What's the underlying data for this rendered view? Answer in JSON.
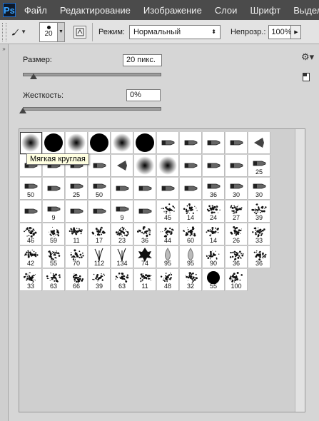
{
  "app": {
    "logo": "Ps"
  },
  "menubar": {
    "items": [
      "Файл",
      "Редактирование",
      "Изображение",
      "Слои",
      "Шрифт",
      "Выделен"
    ]
  },
  "options_bar": {
    "brush_size_value": "20",
    "mode_label": "Режим:",
    "mode_value": "Нормальный",
    "opacity_label": "Непрозр.:",
    "opacity_value": "100%"
  },
  "brush_popup": {
    "size_label": "Размер:",
    "size_value": "20 пикс.",
    "size_slider_fraction": 0.08,
    "hardness_label": "Жесткость:",
    "hardness_value": "0%",
    "hardness_slider_fraction": 0.0,
    "tooltip": "Мягкая круглая",
    "presets": [
      {
        "kind": "soft",
        "label": ""
      },
      {
        "kind": "hard",
        "label": ""
      },
      {
        "kind": "soft",
        "label": ""
      },
      {
        "kind": "hard",
        "label": ""
      },
      {
        "kind": "soft",
        "label": ""
      },
      {
        "kind": "hard",
        "label": ""
      },
      {
        "kind": "marker",
        "label": ""
      },
      {
        "kind": "marker",
        "label": ""
      },
      {
        "kind": "marker",
        "label": ""
      },
      {
        "kind": "marker",
        "label": ""
      },
      {
        "kind": "fan",
        "label": ""
      },
      {
        "kind": "marker",
        "label": ""
      },
      {
        "kind": "marker",
        "label": ""
      },
      {
        "kind": "marker",
        "label": ""
      },
      {
        "kind": "marker",
        "label": ""
      },
      {
        "kind": "fan",
        "label": ""
      },
      {
        "kind": "soft",
        "label": ""
      },
      {
        "kind": "soft",
        "label": ""
      },
      {
        "kind": "marker",
        "label": ""
      },
      {
        "kind": "marker",
        "label": ""
      },
      {
        "kind": "marker",
        "label": ""
      },
      {
        "kind": "marker",
        "label": "25"
      },
      {
        "kind": "marker",
        "label": "50"
      },
      {
        "kind": "marker",
        "label": ""
      },
      {
        "kind": "marker",
        "label": "25"
      },
      {
        "kind": "marker",
        "label": "50"
      },
      {
        "kind": "marker",
        "label": ""
      },
      {
        "kind": "marker",
        "label": ""
      },
      {
        "kind": "marker",
        "label": ""
      },
      {
        "kind": "marker",
        "label": ""
      },
      {
        "kind": "marker",
        "label": "36"
      },
      {
        "kind": "marker",
        "label": "30"
      },
      {
        "kind": "marker",
        "label": "30"
      },
      {
        "kind": "marker",
        "label": ""
      },
      {
        "kind": "marker",
        "label": "9"
      },
      {
        "kind": "marker",
        "label": ""
      },
      {
        "kind": "marker",
        "label": ""
      },
      {
        "kind": "marker",
        "label": "9"
      },
      {
        "kind": "marker",
        "label": ""
      },
      {
        "kind": "texture",
        "label": "45"
      },
      {
        "kind": "texture",
        "label": "14"
      },
      {
        "kind": "texture",
        "label": "24"
      },
      {
        "kind": "texture",
        "label": "27"
      },
      {
        "kind": "texture",
        "label": "39"
      },
      {
        "kind": "texture",
        "label": "46"
      },
      {
        "kind": "texture",
        "label": "59"
      },
      {
        "kind": "texture",
        "label": "11"
      },
      {
        "kind": "texture",
        "label": "17"
      },
      {
        "kind": "texture",
        "label": "23"
      },
      {
        "kind": "texture",
        "label": "36"
      },
      {
        "kind": "texture",
        "label": "44"
      },
      {
        "kind": "texture",
        "label": "60"
      },
      {
        "kind": "texture",
        "label": "14"
      },
      {
        "kind": "texture",
        "label": "26"
      },
      {
        "kind": "texture",
        "label": "33"
      },
      {
        "kind": "texture",
        "label": "42"
      },
      {
        "kind": "texture",
        "label": "55"
      },
      {
        "kind": "texture",
        "label": "70"
      },
      {
        "kind": "grass",
        "label": "112"
      },
      {
        "kind": "grass",
        "label": "134"
      },
      {
        "kind": "leaf",
        "label": "74"
      },
      {
        "kind": "drop",
        "label": "95"
      },
      {
        "kind": "drop",
        "label": "95"
      },
      {
        "kind": "texture",
        "label": "90"
      },
      {
        "kind": "texture",
        "label": "36"
      },
      {
        "kind": "texture",
        "label": "36"
      },
      {
        "kind": "texture",
        "label": "33"
      },
      {
        "kind": "texture",
        "label": "63"
      },
      {
        "kind": "texture",
        "label": "66"
      },
      {
        "kind": "texture",
        "label": "39"
      },
      {
        "kind": "texture",
        "label": "63"
      },
      {
        "kind": "texture",
        "label": "11"
      },
      {
        "kind": "texture",
        "label": "48"
      },
      {
        "kind": "texture",
        "label": "32"
      },
      {
        "kind": "hard",
        "label": "55"
      },
      {
        "kind": "texture",
        "label": "100"
      }
    ]
  }
}
